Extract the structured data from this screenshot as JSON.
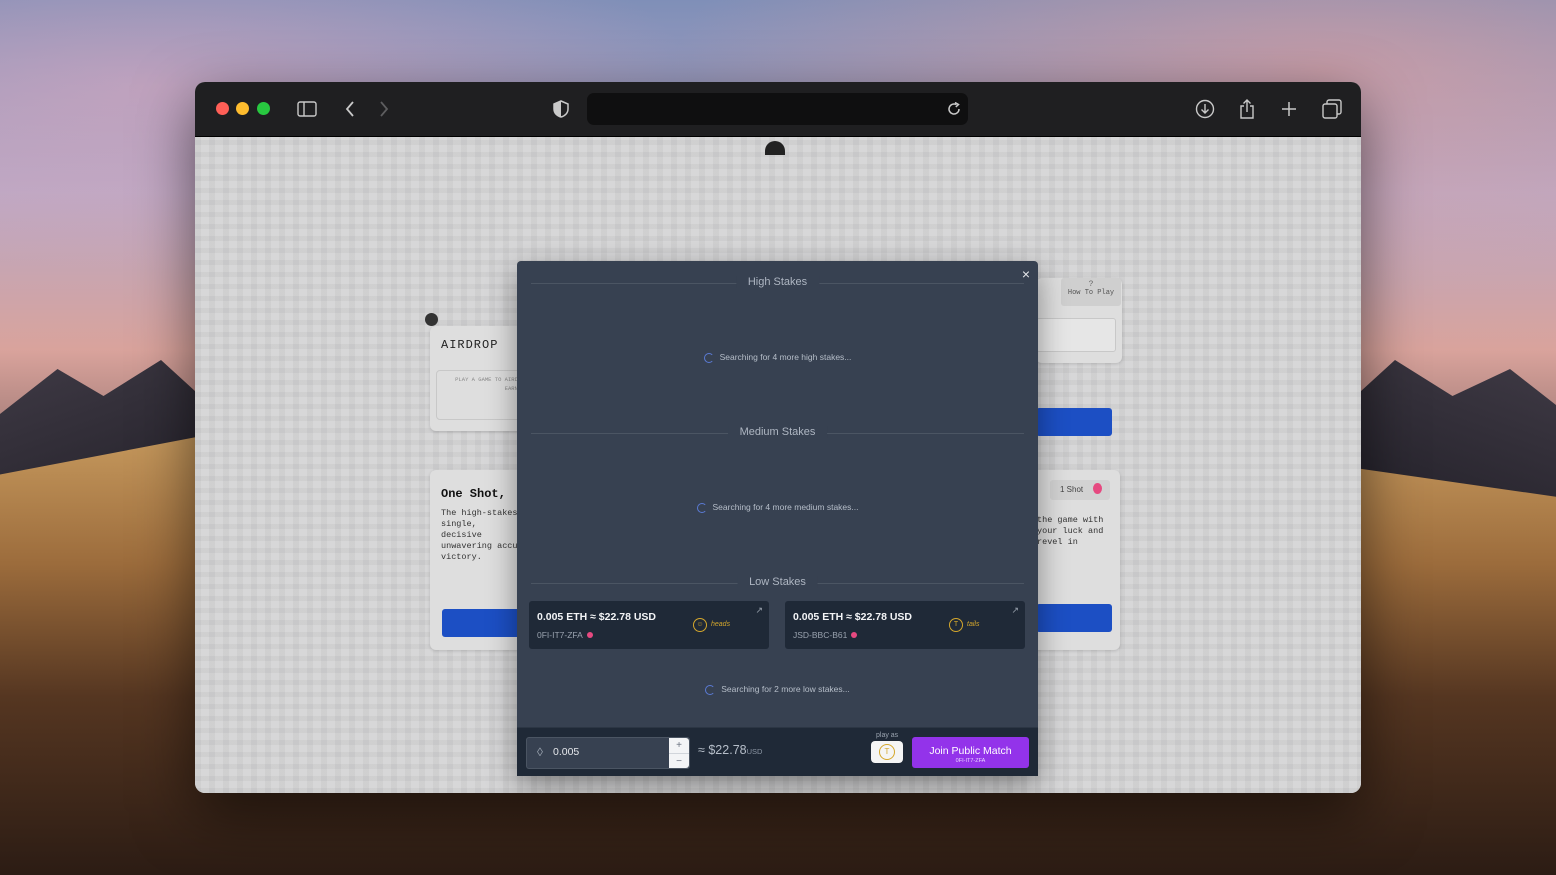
{
  "browser": {
    "address": ""
  },
  "background_page": {
    "logo": "AIRDROP",
    "tagline": "PLAY A GAME TO AIRDROP AND EARN TO WIN",
    "how_to_play_icon": "?",
    "how_to_play": "How To Play",
    "section_title": "One Shot,",
    "section_text": "The high-stakes single, decisive unwavering accu victory.",
    "right_text": "the game with your luck and revel in",
    "one_shot_badge": "1 Shot"
  },
  "modal": {
    "close_label": "×",
    "high": {
      "title": "High Stakes",
      "searching": "Searching for 4 more high stakes..."
    },
    "medium": {
      "title": "Medium Stakes",
      "searching": "Searching for 4 more medium stakes..."
    },
    "low": {
      "title": "Low Stakes",
      "matches": [
        {
          "amount": "0.005 ETH ≈ $22.78 USD",
          "code": "0FI-IT7-ZFA",
          "side": "heads",
          "coin_icon": "heads-coin-icon"
        },
        {
          "amount": "0.005 ETH ≈ $22.78 USD",
          "code": "JSD-BBC-B61",
          "side": "tails",
          "coin_icon": "tails-coin-icon"
        }
      ],
      "searching": "Searching for 2 more low stakes..."
    },
    "footer": {
      "amount_value": "0.005",
      "approx_symbol": "≈",
      "usd_value": "$22.78",
      "usd_unit": "USD",
      "play_as": "play as",
      "join_label": "Join Public Match",
      "join_code": "0FI-IT7-ZFA"
    }
  }
}
